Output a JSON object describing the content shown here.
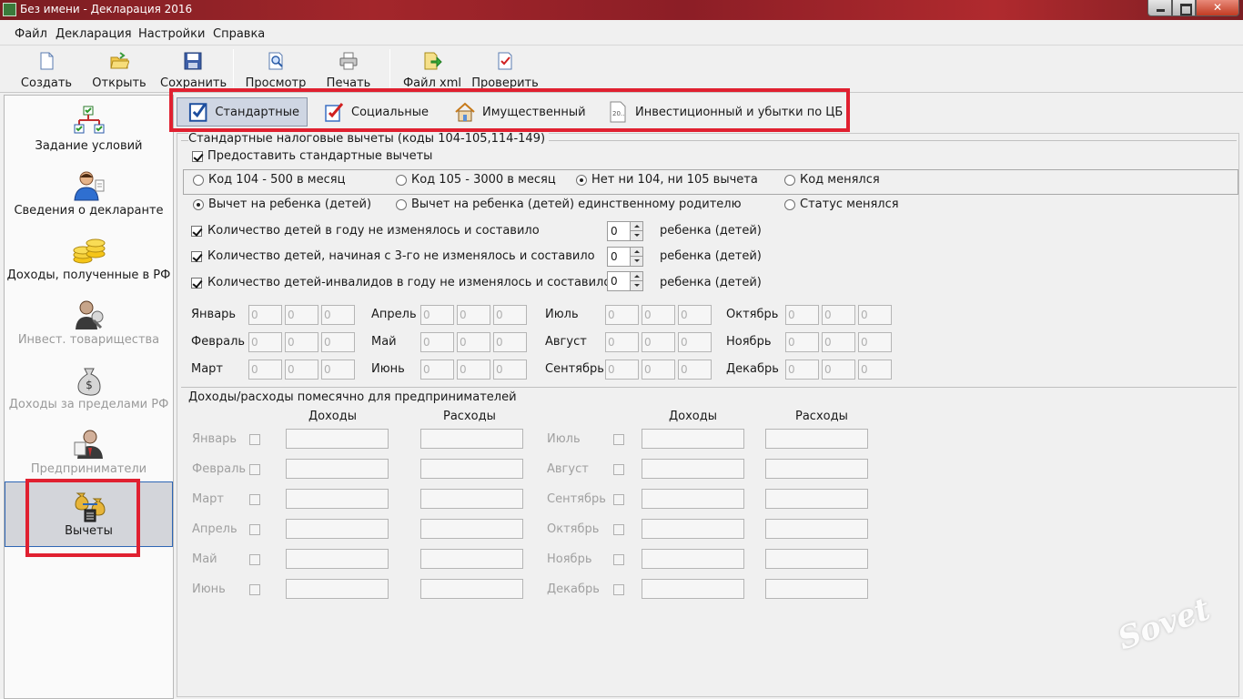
{
  "window": {
    "title": "Без имени - Декларация 2016"
  },
  "menu": [
    "Файл",
    "Декларация",
    "Настройки",
    "Справка"
  ],
  "toolbar": {
    "create": "Создать",
    "open": "Открыть",
    "save": "Сохранить",
    "preview": "Просмотр",
    "print": "Печать",
    "xml": "Файл xml",
    "check": "Проверить"
  },
  "nav": [
    {
      "label": "Задание условий",
      "icon": "conditions-icon",
      "enabled": true
    },
    {
      "label": "Сведения о декларанте",
      "icon": "person-icon",
      "enabled": true
    },
    {
      "label": "Доходы, полученные в РФ",
      "icon": "coins-icon",
      "enabled": true
    },
    {
      "label": "Инвест. товарищества",
      "icon": "partnership-icon",
      "enabled": false
    },
    {
      "label": "Доходы за пределами РФ",
      "icon": "money-bag-icon",
      "enabled": false
    },
    {
      "label": "Предприниматели",
      "icon": "businessman-icon",
      "enabled": false
    },
    {
      "label": "Вычеты",
      "icon": "deductions-icon",
      "enabled": true,
      "selected": true
    }
  ],
  "tabs": [
    "Стандартные",
    "Социальные",
    "Имущественный",
    "Инвестиционный и убытки по ЦБ"
  ],
  "tab_badge": "20..",
  "standard": {
    "group_title": "Стандартные налоговые вычеты (коды 104-105,114-149)",
    "provide": "Предоставить стандартные вычеты",
    "codes": [
      "Код 104 - 500 в месяц",
      "Код 105 - 3000 в месяц",
      "Нет ни 104, ни 105 вычета",
      "Код менялся"
    ],
    "child": [
      "Вычет на ребенка (детей)",
      "Вычет на ребенка (детей) единственному родителю",
      "Статус менялся"
    ],
    "counts": [
      {
        "label": "Количество детей в году не изменялось и составило",
        "value": "0",
        "unit": "ребенка (детей)"
      },
      {
        "label": "Количество детей, начиная с 3-го не изменялось и составило",
        "value": "0",
        "unit": "ребенка (детей)"
      },
      {
        "label": "Количество детей-инвалидов в году не изменялось и составило",
        "value": "0",
        "unit": "ребенка (детей)"
      }
    ],
    "months": [
      "Январь",
      "Февраль",
      "Март",
      "Апрель",
      "Май",
      "Июнь",
      "Июль",
      "Август",
      "Сентябрь",
      "Октябрь",
      "Ноябрь",
      "Декабрь"
    ],
    "month_value": "0"
  },
  "entrepreneurs": {
    "group_title": "Доходы/расходы помесячно для предпринимателей",
    "income": "Доходы",
    "expense": "Расходы",
    "months_left": [
      "Январь",
      "Февраль",
      "Март",
      "Апрель",
      "Май",
      "Июнь"
    ],
    "months_right": [
      "Июль",
      "Август",
      "Сентябрь",
      "Октябрь",
      "Ноябрь",
      "Декабрь"
    ]
  },
  "watermark": "club Sovet"
}
